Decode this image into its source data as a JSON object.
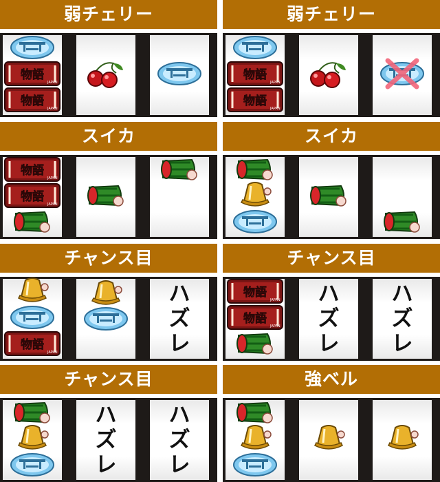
{
  "panels": [
    {
      "title": "弱チェリー",
      "reels": [
        [
          "taiko",
          "logo",
          "logo"
        ],
        [
          "cherry"
        ],
        [
          "taiko"
        ]
      ],
      "crossed": [
        false,
        false,
        false
      ]
    },
    {
      "title": "弱チェリー",
      "reels": [
        [
          "taiko",
          "logo",
          "logo"
        ],
        [
          "cherry"
        ],
        [
          "taiko"
        ]
      ],
      "crossed": [
        false,
        false,
        true
      ]
    },
    {
      "title": "スイカ",
      "reels": [
        [
          "logo",
          "logo",
          "watermelon"
        ],
        [
          "watermelon"
        ],
        [
          "watermelon"
        ]
      ],
      "crossed": [
        false,
        false,
        false
      ]
    },
    {
      "title": "スイカ",
      "reels": [
        [
          "watermelon",
          "bell",
          "taiko"
        ],
        [
          "watermelon"
        ],
        [
          "watermelon"
        ]
      ],
      "crossed": [
        false,
        false,
        false
      ]
    },
    {
      "title": "チャンス目",
      "reels": [
        [
          "bell",
          "taiko",
          "logo"
        ],
        [
          "bell",
          "taiko"
        ],
        []
      ],
      "crossed": [
        false,
        false,
        false
      ],
      "hazure": [
        false,
        false,
        true
      ]
    },
    {
      "title": "チャンス目",
      "reels": [
        [
          "logo",
          "logo",
          "watermelon"
        ],
        [],
        []
      ],
      "crossed": [
        false,
        false,
        false
      ],
      "hazure": [
        false,
        true,
        true
      ]
    },
    {
      "title": "チャンス目",
      "reels": [
        [
          "watermelon",
          "bell",
          "taiko"
        ],
        [],
        []
      ],
      "crossed": [
        false,
        false,
        false
      ],
      "hazure": [
        false,
        true,
        true
      ]
    },
    {
      "title": "強ベル",
      "reels": [
        [
          "watermelon",
          "bell",
          "taiko"
        ],
        [
          "bell"
        ],
        [
          "bell"
        ]
      ],
      "crossed": [
        false,
        false,
        false
      ]
    }
  ],
  "hazure_label": "ハズレ",
  "colors": {
    "header": "#b26e05",
    "frame": "#1e1a18"
  }
}
